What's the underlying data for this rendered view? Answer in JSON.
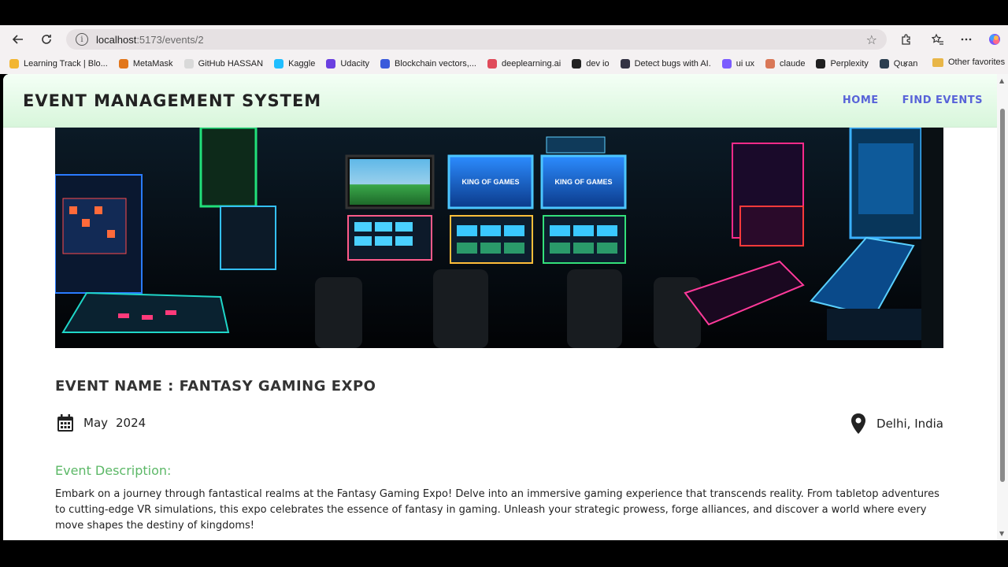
{
  "browser": {
    "url_host": "localhost",
    "url_path": ":5173/events/2",
    "bookmarks": [
      {
        "label": "Learning Track | Blo...",
        "color": "#f2b632"
      },
      {
        "label": "MetaMask",
        "color": "#e2761b"
      },
      {
        "label": "GitHub HASSAN",
        "color": "#d9d9d9"
      },
      {
        "label": "Kaggle",
        "color": "#20beff"
      },
      {
        "label": "Udacity",
        "color": "#6a3fe0"
      },
      {
        "label": "Blockchain vectors,...",
        "color": "#3b5bdb"
      },
      {
        "label": "deeplearning.ai",
        "color": "#e04a5a"
      },
      {
        "label": "dev io",
        "color": "#222222"
      },
      {
        "label": "Detect bugs with AI.",
        "color": "#334"
      },
      {
        "label": "ui ux",
        "color": "#7b5cff"
      },
      {
        "label": "claude",
        "color": "#d97757"
      },
      {
        "label": "Perplexity",
        "color": "#1f1f1f"
      },
      {
        "label": "Quran",
        "color": "#2b3e50"
      }
    ],
    "other_favorites": "Other favorites"
  },
  "site": {
    "title": "EVENT MANAGEMENT SYSTEM",
    "nav": {
      "home": "HOME",
      "find_events": "FIND EVENTS"
    }
  },
  "event": {
    "name": "EVENT NAME : FANTASY GAMING EXPO",
    "month": "May",
    "year": "2024",
    "location": "Delhi, India",
    "description_heading": "Event Description:",
    "description": "Embark on a journey through fantastical realms at the Fantasy Gaming Expo! Delve into an immersive gaming experience that transcends reality. From tabletop adventures to cutting-edge VR simulations, this expo celebrates the essence of fantasy in gaming. Unleash your strategic prowess, forge alliances, and discover a world where every move shapes the destiny of kingdoms!",
    "screen_text": "KING OF GAMES"
  },
  "colors": {
    "accent_nav": "#5863d8",
    "accent_heading": "#5cb867"
  }
}
